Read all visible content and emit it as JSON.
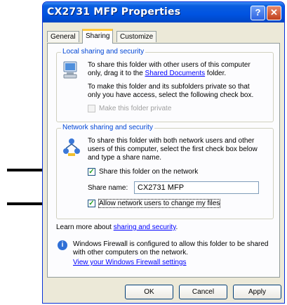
{
  "window": {
    "title": "CX2731 MFP Properties",
    "help_glyph": "?",
    "close_glyph": "✕"
  },
  "tabs": [
    {
      "label": "General"
    },
    {
      "label": "Sharing",
      "active": true
    },
    {
      "label": "Customize"
    }
  ],
  "local": {
    "legend": "Local sharing and security",
    "line1": "To share this folder with other users of this computer",
    "line2_pre": "only, drag it to the ",
    "line2_link": "Shared Documents",
    "line2_post": " folder.",
    "line3": "To make this folder and its subfolders private so that",
    "line4": "only you have access, select the following check box.",
    "private_label": "Make this folder private",
    "private_checked": false
  },
  "network": {
    "legend": "Network sharing and security",
    "line1": "To share this folder with both network users and other",
    "line2": "users of this computer, select the first check box below",
    "line3": "and type a share name.",
    "share_label": "Share this folder on the network",
    "share_checked": true,
    "share_name_label": "Share name:",
    "share_name_value": "CX2731 MFP",
    "allow_label": "Allow network users to change my files",
    "allow_checked": true,
    "check_glyph": "✓"
  },
  "learn": {
    "pre": "Learn more about ",
    "link": "sharing and security",
    "post": "."
  },
  "firewall": {
    "line1": "Windows Firewall is configured to allow this folder to be shared",
    "line2": "with other computers on the network.",
    "link": "View your Windows Firewall settings",
    "icon_glyph": "i"
  },
  "buttons": {
    "ok": "OK",
    "cancel": "Cancel",
    "apply": "Apply"
  },
  "colors": {
    "title_bar": "#0053e1",
    "dialog": "#ece9d8",
    "legend": "#0046d5",
    "link": "#0000ff",
    "check": "#21a121"
  }
}
